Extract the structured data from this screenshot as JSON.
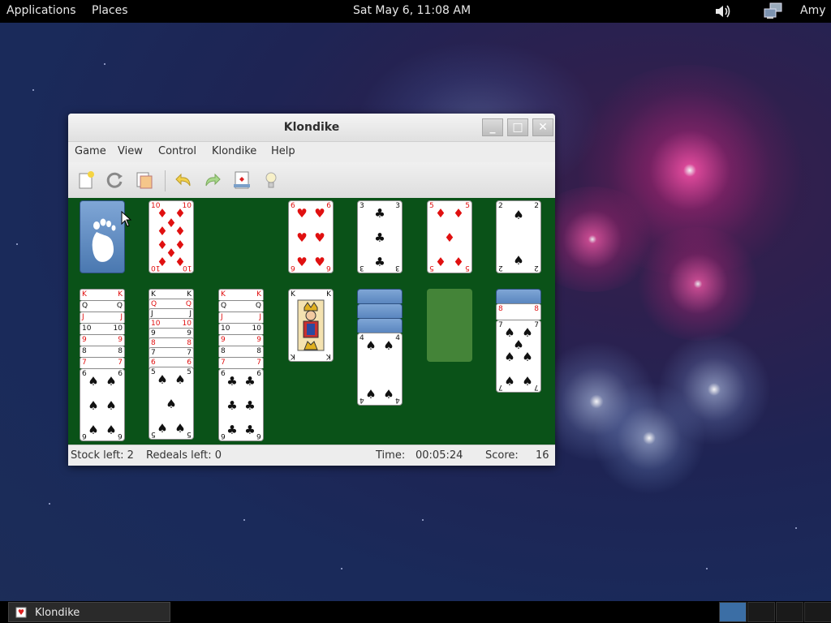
{
  "top_panel": {
    "applications": "Applications",
    "places": "Places",
    "clock": "Sat May  6, 11:08 AM",
    "user": "Amy",
    "volume_icon": "speaker-icon",
    "network_icon": "network-icon"
  },
  "window": {
    "title": "Klondike",
    "minimize": "_",
    "maximize": "□",
    "close": "✕",
    "menus": [
      "Game",
      "View",
      "Control",
      "Klondike",
      "Help"
    ],
    "toolbar": [
      "new-game-icon",
      "restart-icon",
      "select-game-icon",
      "undo-icon",
      "redo-icon",
      "deal-icon",
      "hint-icon"
    ],
    "status": {
      "stock": "Stock left: 2",
      "redeals": "Redeals left: 0",
      "time_label": "Time:",
      "time_value": "00:05:24",
      "score_label": "Score:",
      "score_value": "16"
    }
  },
  "game": {
    "waste_card": {
      "rank": "10",
      "suit": "♦"
    },
    "foundations": [
      {
        "rank": "6",
        "suit": "♥"
      },
      {
        "rank": "3",
        "suit": "♣"
      },
      {
        "rank": "5",
        "suit": "♦"
      },
      {
        "rank": "2",
        "suit": "♠"
      }
    ],
    "tableau_1_strips": [
      {
        "rank": "K",
        "suit": "♥"
      },
      {
        "rank": "Q",
        "suit": "♣"
      },
      {
        "rank": "J",
        "suit": "♦"
      },
      {
        "rank": "10",
        "suit": "♠"
      },
      {
        "rank": "9",
        "suit": "♦"
      },
      {
        "rank": "8",
        "suit": "♠"
      },
      {
        "rank": "7",
        "suit": "♥"
      }
    ],
    "tableau_1_top": {
      "rank": "6",
      "suit": "♠"
    },
    "tableau_2_strips": [
      {
        "rank": "K",
        "suit": "♣"
      },
      {
        "rank": "Q",
        "suit": "♦"
      },
      {
        "rank": "J",
        "suit": "♣"
      },
      {
        "rank": "10",
        "suit": "♥"
      },
      {
        "rank": "9",
        "suit": "♠"
      },
      {
        "rank": "8",
        "suit": "♦"
      },
      {
        "rank": "7",
        "suit": "♣"
      },
      {
        "rank": "6",
        "suit": "♥"
      }
    ],
    "tableau_2_top": {
      "rank": "5",
      "suit": "♠"
    },
    "tableau_3_strips": [
      {
        "rank": "K",
        "suit": "♦"
      },
      {
        "rank": "Q",
        "suit": "♠"
      },
      {
        "rank": "J",
        "suit": "♥"
      },
      {
        "rank": "10",
        "suit": "♣"
      },
      {
        "rank": "9",
        "suit": "♥"
      },
      {
        "rank": "8",
        "suit": "♣"
      },
      {
        "rank": "7",
        "suit": "♦"
      }
    ],
    "tableau_3_top": {
      "rank": "6",
      "suit": "♣"
    },
    "tableau_4_top": {
      "rank": "K",
      "suit": "♣"
    },
    "tableau_5_top": {
      "rank": "4",
      "suit": "♠"
    },
    "tableau_7_strip": {
      "rank": "8",
      "suit": "♥"
    },
    "tableau_7_top": {
      "rank": "7",
      "suit": "♠"
    }
  },
  "taskbar": {
    "task_label": "Klondike"
  }
}
